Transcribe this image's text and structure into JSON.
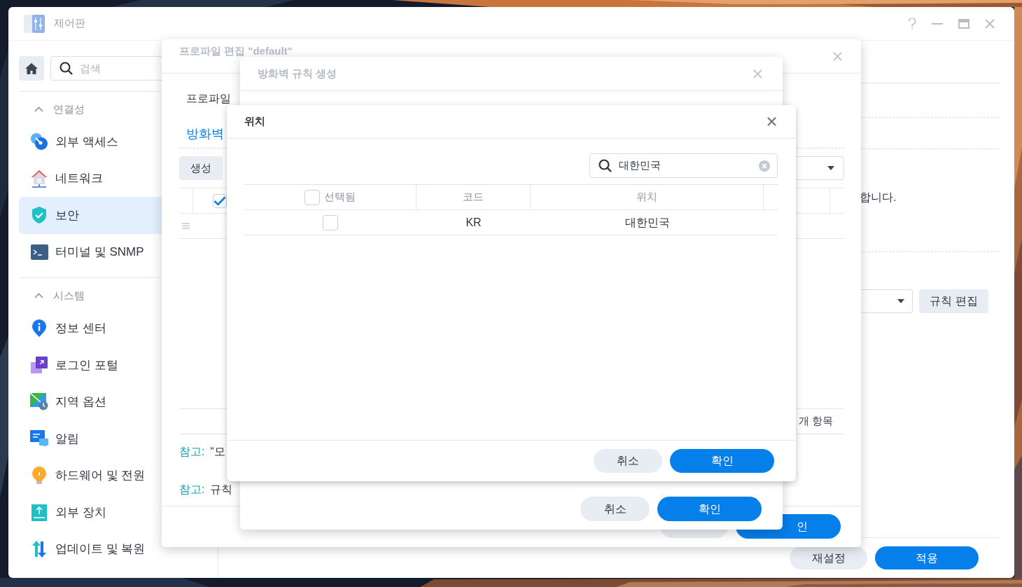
{
  "window": {
    "title": "제어판"
  },
  "sidebar": {
    "search": {
      "placeholder": "검색"
    },
    "sections": [
      {
        "title": "연결성",
        "expanded": true,
        "items": [
          {
            "label": "외부 액세스",
            "selected": false
          },
          {
            "label": "네트워크",
            "selected": false
          },
          {
            "label": "보안",
            "selected": true
          },
          {
            "label": "터미널 및 SNMP",
            "selected": false
          }
        ]
      },
      {
        "title": "시스템",
        "expanded": true,
        "items": [
          {
            "label": "정보 센터",
            "selected": false
          },
          {
            "label": "로그인 포털",
            "selected": false
          },
          {
            "label": "지역 옵션",
            "selected": false
          },
          {
            "label": "알림",
            "selected": false
          },
          {
            "label": "하드웨어 및 전원",
            "selected": false
          },
          {
            "label": "외부 장치",
            "selected": false
          },
          {
            "label": "업데이트 및 복원",
            "selected": false
          }
        ]
      }
    ]
  },
  "main": {
    "notice_tail": "합니다.",
    "rules_button": "규칙 편집",
    "reset_button": "재설정",
    "apply_button": "적용"
  },
  "profile_dialog": {
    "title": "프로파일 편집 \"default\"",
    "field_label": "프로파일",
    "tabs": [
      {
        "label": "방화벽",
        "selected": true
      }
    ],
    "create_button": "생성",
    "header_checkbox_checked": true,
    "item_count": "개 항목",
    "notes": [
      {
        "label": "참고:",
        "text": "“모"
      },
      {
        "label": "참고:",
        "text": "규칙"
      }
    ],
    "confirm_button": "인"
  },
  "rule_dialog": {
    "title": "방화벽 규칙 생성",
    "cancel_button": "취소",
    "confirm_button": "확인"
  },
  "location_dialog": {
    "title": "위치",
    "search": {
      "value": "대한민국"
    },
    "columns": [
      "선택됨",
      "코드",
      "위치"
    ],
    "select_all_checked": false,
    "rows": [
      {
        "checked": false,
        "code": "KR",
        "location": "대한민국"
      }
    ],
    "cancel_button": "취소",
    "confirm_button": "확인"
  }
}
